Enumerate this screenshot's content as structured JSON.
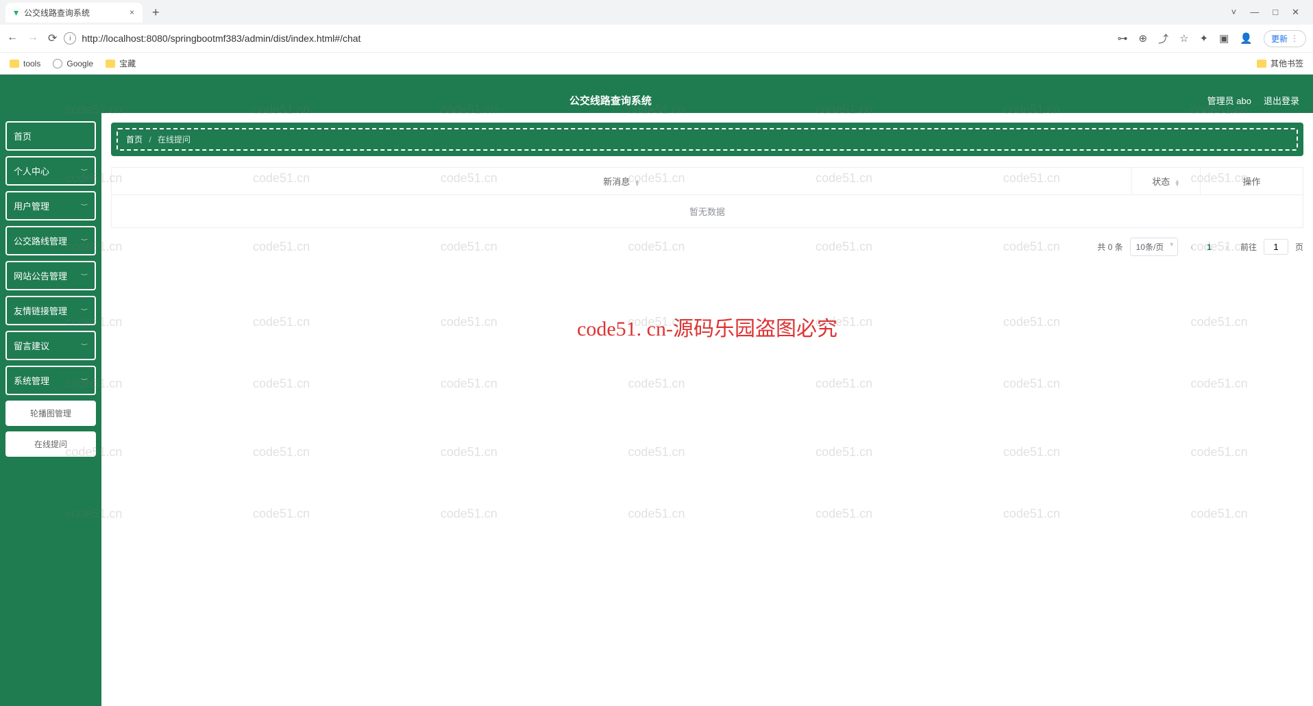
{
  "browser": {
    "tab_title": "公交线路查询系统",
    "url": "http://localhost:8080/springbootmf383/admin/dist/index.html#/chat",
    "update_label": "更新",
    "bookmarks": {
      "tools": "tools",
      "google": "Google",
      "treasure": "宝藏",
      "other": "其他书签"
    },
    "window": {
      "minimize": "—",
      "maximize": "□",
      "close": "✕"
    }
  },
  "header": {
    "title": "公交线路查询系统",
    "user_label": "管理员 abo",
    "logout": "退出登录"
  },
  "sidebar": {
    "items": [
      {
        "label": "首页",
        "expandable": false
      },
      {
        "label": "个人中心",
        "expandable": true
      },
      {
        "label": "用户管理",
        "expandable": true
      },
      {
        "label": "公交路线管理",
        "expandable": true
      },
      {
        "label": "网站公告管理",
        "expandable": true
      },
      {
        "label": "友情链接管理",
        "expandable": true
      },
      {
        "label": "留言建议",
        "expandable": true
      },
      {
        "label": "系统管理",
        "expandable": true
      }
    ],
    "subitems": [
      {
        "label": "轮播图管理"
      },
      {
        "label": "在线提问"
      }
    ]
  },
  "breadcrumb": {
    "home": "首页",
    "current": "在线提问"
  },
  "table": {
    "col_message": "新消息",
    "col_status": "状态",
    "col_action": "操作",
    "empty": "暂无数据"
  },
  "pagination": {
    "total_text": "共 0 条",
    "page_size": "10条/页",
    "current": "1",
    "goto_prefix": "前往",
    "goto_value": "1",
    "goto_suffix": "页"
  },
  "watermark": {
    "main": "code51. cn-源码乐园盗图必究",
    "bg": "code51.cn"
  }
}
